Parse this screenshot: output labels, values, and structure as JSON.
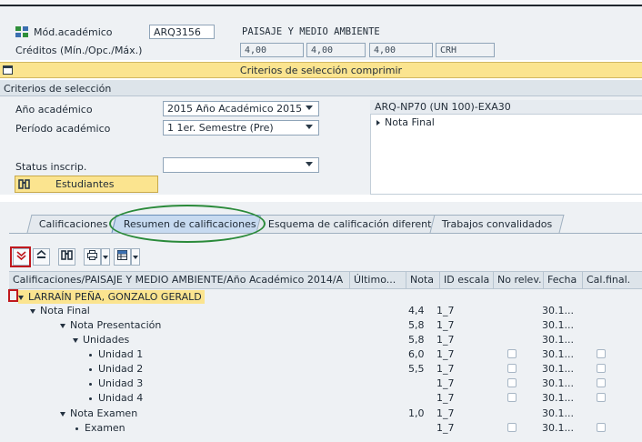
{
  "header": {
    "modulo_label": "Mód.académico",
    "modulo_value": "ARQ3156",
    "modulo_name": "PAISAJE Y MEDIO AMBIENTE",
    "creditos_label": "Créditos (Mín./Opc./Máx.)",
    "cred_min": "4,00",
    "cred_opc": "4,00",
    "cred_max": "4,00",
    "cred_unit": "CRH"
  },
  "criteria_bar": {
    "title": "Criterios de selección comprimir"
  },
  "criteria": {
    "section_title": "Criterios de selección",
    "anio_label": "Año académico",
    "anio_value": "2015 Año Académico 2015",
    "periodo_label": "Período académico",
    "periodo_value": "1 1er. Semestre (Pre)",
    "status_label": "Status inscrip.",
    "status_value": "",
    "estudiantes_button": "Estudiantes",
    "right_panel_title": "ARQ-NP70 (UN 100)-EXA30",
    "right_panel_item": "Nota Final"
  },
  "tabs": [
    {
      "label": "Calificaciones"
    },
    {
      "label": "Resumen de calificaciones"
    },
    {
      "label": "Esquema de calificación diferente"
    },
    {
      "label": "Trabajos convalidados"
    }
  ],
  "table": {
    "columns": [
      "Calificaciones/PAISAJE Y MEDIO AMBIENTE/Año Académico 2014/A",
      "Último...",
      "Nota",
      "ID escala",
      "No relev.",
      "Fecha",
      "Cal.final."
    ],
    "rows": [
      {
        "label": "LARRAÍN PEÑA, GONZALO GERALD",
        "nota": "",
        "escala": "",
        "fecha": ""
      },
      {
        "label": "Nota Final",
        "nota": "4,4",
        "escala": "1_7",
        "fecha": "30.1..."
      },
      {
        "label": "Nota Presentación",
        "nota": "5,8",
        "escala": "1_7",
        "fecha": "30.1..."
      },
      {
        "label": "Unidades",
        "nota": "5,8",
        "escala": "1_7",
        "fecha": "30.1..."
      },
      {
        "label": "Unidad 1",
        "nota": "6,0",
        "escala": "1_7",
        "fecha": "30.1..."
      },
      {
        "label": "Unidad 2",
        "nota": "5,5",
        "escala": "1_7",
        "fecha": "30.1..."
      },
      {
        "label": "Unidad 3",
        "nota": "",
        "escala": "1_7",
        "fecha": "30.1..."
      },
      {
        "label": "Unidad 4",
        "nota": "",
        "escala": "1_7",
        "fecha": "30.1..."
      },
      {
        "label": "Nota Examen",
        "nota": "1,0",
        "escala": "1_7",
        "fecha": "30.1..."
      },
      {
        "label": "Examen",
        "nota": "",
        "escala": "1_7",
        "fecha": "30.1..."
      }
    ]
  },
  "colors": {
    "yellow_bar": "#fbe48f",
    "annotation_green": "#2a8a3a",
    "annotation_red": "#c0181d"
  },
  "icons": [
    "module-icon",
    "collapse-icon",
    "find-icon",
    "expand-all-icon",
    "collapse-all-icon",
    "print-icon",
    "layout-icon"
  ]
}
